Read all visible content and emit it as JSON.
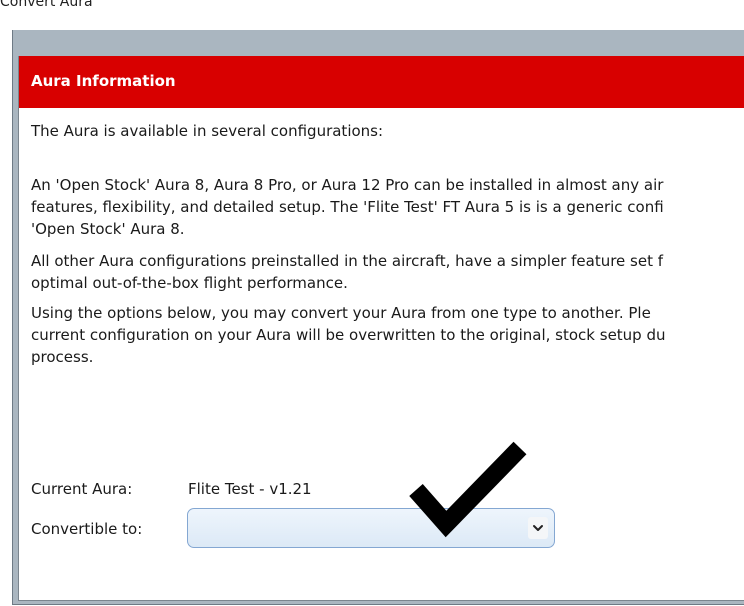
{
  "window": {
    "title": "Convert Aura"
  },
  "panel": {
    "header": "Aura Information",
    "intro": "The Aura is available in several configurations:",
    "para1_lines": [
      "An 'Open Stock' Aura 8, Aura 8 Pro, or Aura 12 Pro can be installed in almost any air",
      "features, flexibility, and detailed setup.  The 'Flite Test' FT Aura 5 is is a generic confi",
      "'Open Stock' Aura 8."
    ],
    "para2_lines": [
      "All other Aura  configurations preinstalled in the aircraft, have a simpler feature set f",
      "optimal out-of-the-box flight performance."
    ],
    "para3_lines": [
      "Using the options below, you may convert your Aura from one type to another.  Ple",
      "current configuration on your Aura will be overwritten to the original, stock setup du",
      "process."
    ],
    "current_label": "Current Aura:",
    "current_value": "Flite Test - v1.21",
    "convertible_label": "Convertible to:",
    "convertible_selected": ""
  },
  "colors": {
    "header_bg": "#d80000",
    "frame_bg": "#aab6c0",
    "select_border": "#84a7d2"
  },
  "icons": {
    "dropdown": "chevron-down-icon",
    "overlay": "checkmark-icon"
  }
}
